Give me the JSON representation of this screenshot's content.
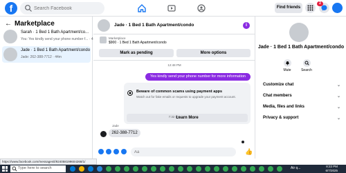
{
  "topbar": {
    "logo": "f",
    "search_placeholder": "Search Facebook",
    "find_friends": "Find friends",
    "notification_count": "2",
    "icons": [
      "home-icon",
      "video-icon",
      "groups-icon",
      "menu-icon",
      "messenger-icon",
      "bell-icon"
    ]
  },
  "left": {
    "title": "Marketplace",
    "back": "←",
    "conversations": [
      {
        "name": "Sarah · 1 Bed 1 Bath Apartment/co...",
        "snippet": "You: Yes kindly send your phone number f... · 4m"
      },
      {
        "name": "Jade · 1 Bed 1 Bath Apartment/condo",
        "snippet": "Jade: 262-388-7712 · 44m"
      }
    ]
  },
  "chat": {
    "title": "Jade · 1 Bed 1 Bath Apartment/condo",
    "info": "i",
    "listing_label": "Marketplace",
    "listing_price": "$900 · 1 Bed 1 Bath Apartment/condo",
    "mark_pending": "Mark as pending",
    "more_options": "More options",
    "time1": "12:48 PM",
    "outgoing": "Yes kindly send your phone number for more information",
    "warning_title": "Beware of common scams using payment apps",
    "warning_desc": "Watch out for fake emails or requests to upgrade your payment account.",
    "learn_more": "Learn More",
    "time2": "7:32 PM",
    "sender": "Jade",
    "incoming": "262-388-7712",
    "composer_placeholder": "Aa",
    "like": "👍"
  },
  "right": {
    "title": "Jade · 1 Bed 1 Bath Apartment/condo",
    "mute": "Mute",
    "search": "Search",
    "rows": [
      "Customize chat",
      "Chat members",
      "Media, files and links",
      "Privacy & support"
    ]
  },
  "status_url": "https://www.facebook.com/messages/t/924058199604268/1/",
  "taskbar": {
    "search_placeholder": "Type here to search",
    "tray_text": "Air q...",
    "time": "8:22 PM",
    "date": "6/7/2025"
  },
  "colors": {
    "brand": "#1877f2",
    "bubble": "#8a2be2",
    "taskbar": "#1f2a3a"
  }
}
